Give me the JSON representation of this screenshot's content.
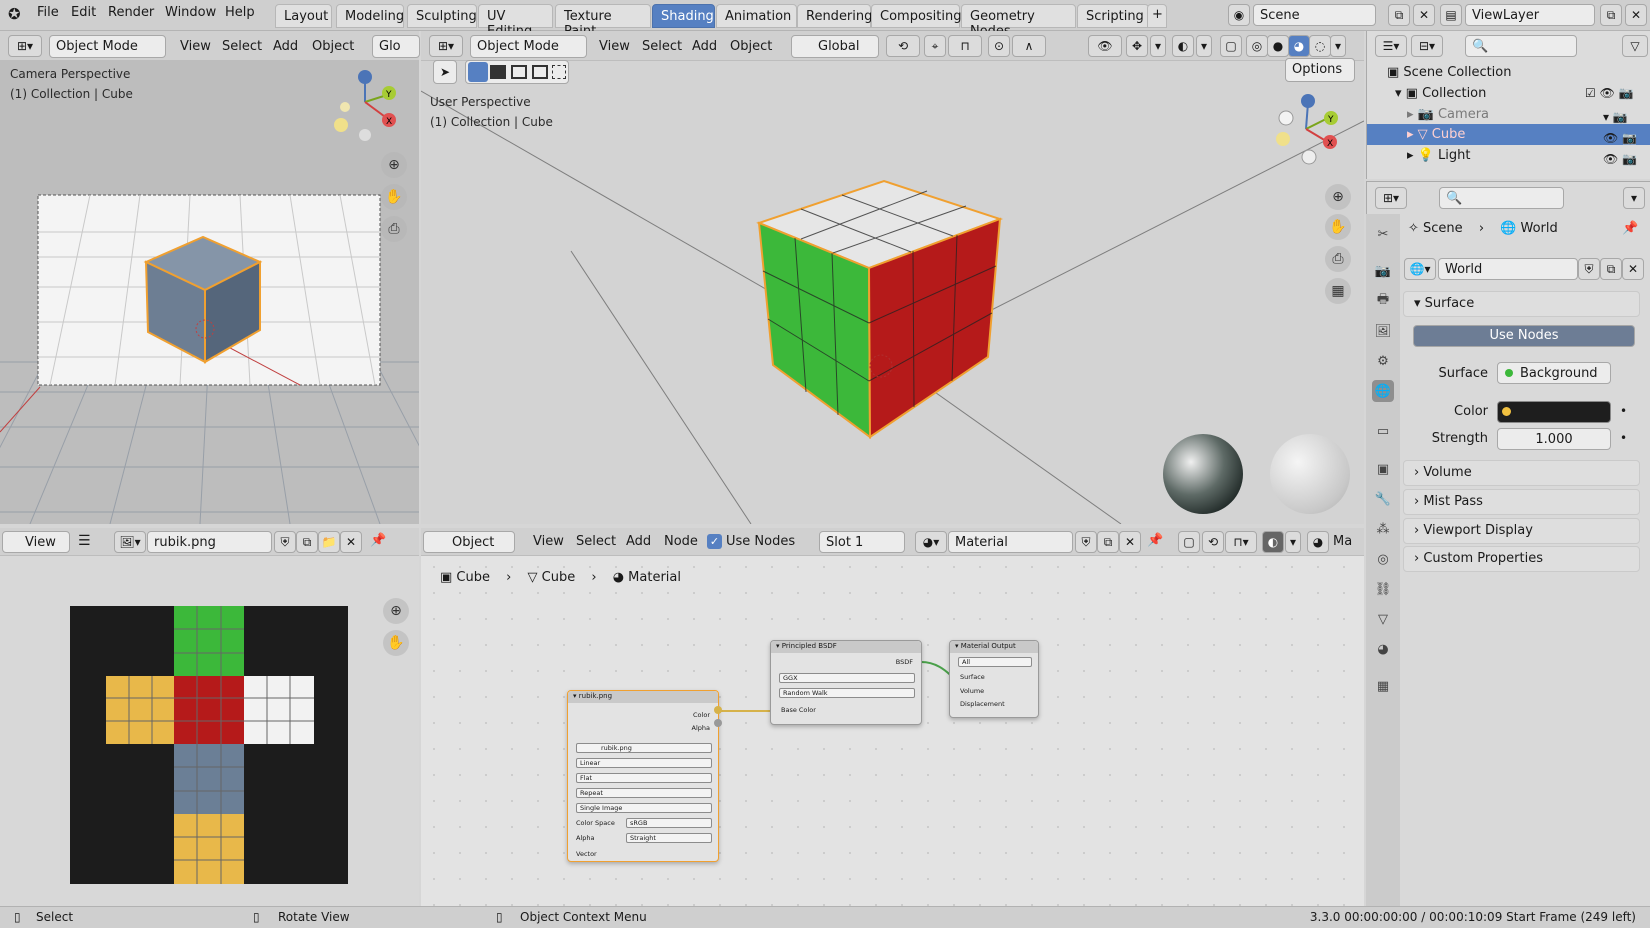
{
  "top_menu": {
    "file": "File",
    "edit": "Edit",
    "render": "Render",
    "window": "Window",
    "help": "Help"
  },
  "workspaces": [
    "Layout",
    "Modeling",
    "Sculpting",
    "UV Editing",
    "Texture Paint",
    "Shading",
    "Animation",
    "Rendering",
    "Compositing",
    "Geometry Nodes",
    "Scripting"
  ],
  "active_workspace": "Shading",
  "add_tab": "+",
  "scene_name": "Scene",
  "view_layer": "ViewLayer",
  "camera_viewport": {
    "mode": "Object Mode",
    "menu": [
      "View",
      "Select",
      "Add",
      "Object"
    ],
    "transform_partial": "Glo",
    "title": "Camera Perspective",
    "subtitle": "(1) Collection | Cube"
  },
  "main_viewport": {
    "mode": "Object Mode",
    "menu": [
      "View",
      "Select",
      "Add",
      "Object"
    ],
    "transform": "Global",
    "options": "Options",
    "title": "User Perspective",
    "subtitle": "(1) Collection | Cube"
  },
  "image_editor": {
    "view": "View",
    "image_name": "rubik.png"
  },
  "node_editor": {
    "type": "Object",
    "menu": [
      "View",
      "Select",
      "Add",
      "Node"
    ],
    "use_nodes": "Use Nodes",
    "slot": "Slot 1",
    "material": "Material",
    "ma_partial": "Ma",
    "breadcrumb": [
      "Cube",
      "Cube",
      "Material"
    ]
  },
  "nodes": {
    "image": {
      "title": "rubik.png",
      "out_color": "Color",
      "out_alpha": "Alpha",
      "file": "rubik.png",
      "interp": "Linear",
      "proj": "Flat",
      "ext": "Repeat",
      "source": "Single Image",
      "cs_label": "Color Space",
      "cs_value": "sRGB",
      "alpha_label": "Alpha",
      "alpha_value": "Straight",
      "vector": "Vector"
    },
    "bsdf": {
      "title": "Principled BSDF",
      "out": "BSDF",
      "dist": "GGX",
      "sss": "Random Walk",
      "base_color": "Base Color"
    },
    "output": {
      "title": "Material Output",
      "target": "All",
      "surface": "Surface",
      "volume": "Volume",
      "displacement": "Displacement"
    }
  },
  "outliner": {
    "root": "Scene Collection",
    "collection": "Collection",
    "items": [
      "Camera",
      "Cube",
      "Light"
    ]
  },
  "properties": {
    "breadcrumb": [
      "Scene",
      "World"
    ],
    "world_name": "World",
    "surface_section": "Surface",
    "use_nodes": "Use Nodes",
    "surface_label": "Surface",
    "surface_value": "Background",
    "color_label": "Color",
    "strength_label": "Strength",
    "strength_value": "1.000",
    "sections": [
      "Volume",
      "Mist Pass",
      "Viewport Display",
      "Custom Properties"
    ]
  },
  "status_bar": {
    "select": "Select",
    "rotate": "Rotate View",
    "context": "Object Context Menu",
    "info": "3.3.0  00:00:00:00 / 00:00:10:09  Start Frame (249 left)"
  },
  "colors": {
    "accent": "#5680c2",
    "selection": "#f0a030",
    "cube_red": "#b51a1a",
    "cube_green": "#3cb83a",
    "cube_white": "#e8e8e8",
    "uv_yellow": "#e8b84a",
    "uv_blue": "#6b7f96"
  }
}
